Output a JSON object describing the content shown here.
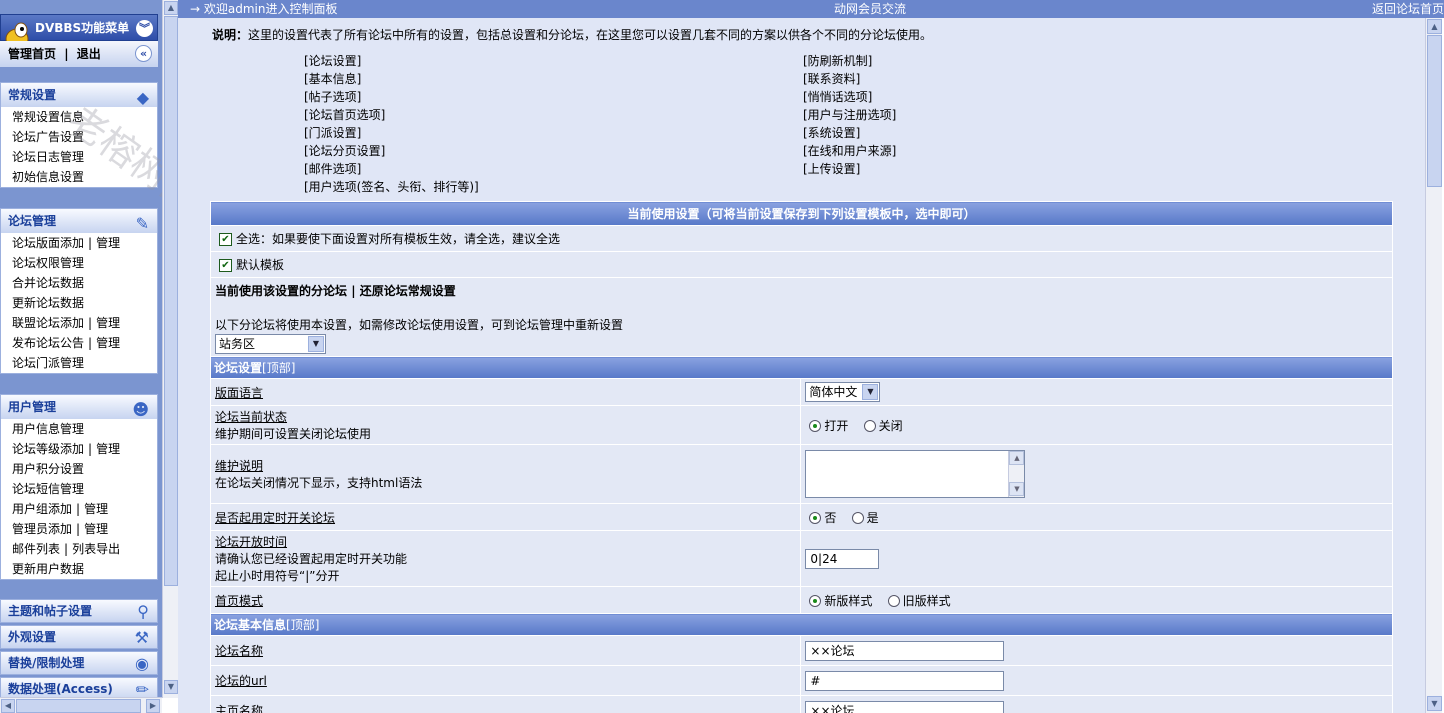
{
  "sidebar": {
    "menu_title": "DVBBS功能菜单",
    "top_nav": {
      "home": "管理首页",
      "sep": "|",
      "logout": "退出"
    },
    "watermark": "老榕树网络",
    "groups": [
      {
        "title": "常规设置",
        "items": [
          "常规设置信息",
          "论坛广告设置",
          "论坛日志管理",
          "初始信息设置"
        ]
      },
      {
        "title": "论坛管理",
        "items": [
          {
            "label": "论坛版面添加",
            "manage": "管理"
          },
          {
            "label": "论坛权限管理"
          },
          {
            "label": "合并论坛数据"
          },
          {
            "label": "更新论坛数据"
          },
          {
            "label": "联盟论坛添加",
            "manage": "管理"
          },
          {
            "label": "发布论坛公告",
            "manage": "管理"
          },
          {
            "label": "论坛门派管理"
          }
        ]
      },
      {
        "title": "用户管理",
        "items": [
          {
            "label": "用户信息管理"
          },
          {
            "label": "论坛等级添加",
            "manage": "管理"
          },
          {
            "label": "用户积分设置"
          },
          {
            "label": "论坛短信管理"
          },
          {
            "label": "用户组添加",
            "manage": "管理"
          },
          {
            "label": "管理员添加",
            "manage": "管理"
          },
          {
            "label": "邮件列表",
            "manage": "列表导出"
          },
          {
            "label": "更新用户数据"
          }
        ]
      }
    ],
    "collapsed": [
      "主题和帖子设置",
      "外观设置",
      "替换/限制处理",
      "数据处理(Access)"
    ]
  },
  "topbar": {
    "welcome": "欢迎admin进入控制面板",
    "member": "动网会员交流",
    "back": "返回论坛首页"
  },
  "main": {
    "desc_label": "说明：",
    "desc_text": "这里的设置代表了所有论坛中所有的设置，包括总设置和分论坛，在这里您可以设置几套不同的方案以供各个不同的分论坛使用。",
    "links_left": [
      "[论坛设置]",
      "[基本信息]",
      "[帖子选项]",
      "[论坛首页选项]",
      "[门派设置]",
      "[论坛分页设置]",
      "[邮件选项]",
      "[用户选项(签名、头衔、排行等)]"
    ],
    "links_right": [
      "[防刷新机制]",
      "[联系资料]",
      "[悄悄话选项]",
      "[用户与注册选项]",
      "[系统设置]",
      "[在线和用户来源]",
      "[上传设置]"
    ],
    "current_header": "当前使用设置（可将当前设置保存到下列设置模板中，选中即可）",
    "select_all": "全选：如果要使下面设置对所有模板生效，请全选，建议全选",
    "default_tpl": "默认模板",
    "cur_forum": "当前使用该设置的分论坛",
    "restore": "还原论坛常规设置",
    "forum_note": "以下分论坛将使用本设置，如需修改论坛使用设置，可到论坛管理中重新设置",
    "forum_select": "站务区",
    "sec1_title": "论坛设置",
    "sec2_title": "论坛基本信息",
    "top_link": "[顶部]",
    "lang_label": "版面语言",
    "lang_value": "简体中文",
    "status_label": "论坛当前状态",
    "status_desc": "维护期间可设置关闭论坛使用",
    "status_open": "打开",
    "status_close": "关闭",
    "maint_label": "维护说明",
    "maint_desc": "在论坛关闭情况下显示，支持html语法",
    "timer_label": "是否起用定时开关论坛",
    "timer_no": "否",
    "timer_yes": "是",
    "open_time_label": "论坛开放时间",
    "open_time_desc1": "请确认您已经设置起用定时开关功能",
    "open_time_desc2": "起止小时用符号“|”分开",
    "open_time_value": "0|24",
    "home_mode_label": "首页模式",
    "home_new": "新版样式",
    "home_old": "旧版样式",
    "name_label": "论坛名称",
    "name_value": "××论坛",
    "url_label": "论坛的url",
    "url_value": "#",
    "homepage_label": "主页名称",
    "homepage_value": "××论坛"
  }
}
